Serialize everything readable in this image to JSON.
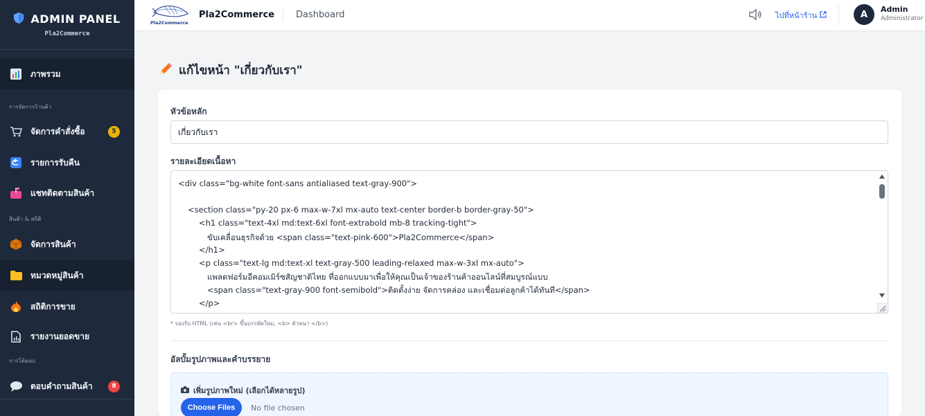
{
  "sidebar": {
    "title": "ADMIN PANEL",
    "subtitle": "Pla2Commerce",
    "sections": [
      "การจัดการร้านค้า",
      "สินค้า & สถิติ",
      "การโต้ตอบ"
    ],
    "items": [
      {
        "label": "ภาพรวม",
        "icon": "bar-chart-icon"
      },
      {
        "label": "จัดการคำสั่งซื้อ",
        "icon": "shopping-cart-icon",
        "badge": "5"
      },
      {
        "label": "รายการรับคืน",
        "icon": "return-arrow-icon"
      },
      {
        "label": "แชทติดตามสินค้า",
        "icon": "mailbox-icon"
      },
      {
        "label": "จัดการสินค้า",
        "icon": "package-icon"
      },
      {
        "label": "หมวดหมู่สินค้า",
        "icon": "folder-icon"
      },
      {
        "label": "สถิติการขาย",
        "icon": "fire-icon"
      },
      {
        "label": "รายงานยอดขาย",
        "icon": "report-icon"
      },
      {
        "label": "ตอบคำถามสินค้า",
        "icon": "speech-bubble-icon",
        "badge": "8"
      }
    ]
  },
  "header": {
    "store_name": "Pla2Commerce",
    "page": "Dashboard",
    "logo_text": "Pla2Commerce",
    "store_link": "ไปที่หน้าร้าน",
    "user": {
      "initial": "A",
      "name": "Admin",
      "role": "Administrator"
    }
  },
  "main": {
    "title": "แก้ไขหน้า \"เกี่ยวกับเรา\"",
    "heading_label": "หัวข้อหลัก",
    "heading_value": "เกี่ยวกับเรา",
    "content_label": "รายละเอียดเนื้อหา",
    "content_lines": [
      "<div class=\"bg-white font-sans antialiased text-gray-900\">",
      "",
      "<section class=\"py-20 px-6 max-w-7xl mx-auto text-center border-b border-gray-50\">",
      "<h1 class=\"text-4xl md:text-6xl font-extrabold mb-8 tracking-tight\">",
      "ขับเคลื่อนธุรกิจด้วย <span class=\"text-pink-600\">Pla2Commerce</span>",
      "</h1>",
      "<p class=\"text-lg md:text-xl text-gray-500 leading-relaxed max-w-3xl mx-auto\">",
      "แพลตฟอร์มอีคอมเมิร์ซสัญชาติไทย ที่ออกแบบมาเพื่อให้คุณเป็นเจ้าของร้านค้าออนไลน์ที่สมบูรณ์แบบ",
      "<span class=\"text-gray-900 font-semibold\">ติดตั้งง่าย จัดการคล่อง และเชื่อมต่อลูกค้าได้ทันที</span>",
      "</p>"
    ],
    "content_hint": "* รองรับ HTML (เช่น <br> ขึ้นบรรทัดใหม่, <b> ตัวหนา </b>)",
    "album_label": "อัลบั้มรูปภาพและคำบรรยาย",
    "upload_label": "เพิ่มรูปภาพใหม่ (เลือกได้หลายรูป)",
    "choose_files": "Choose Files",
    "file_status": "No file chosen"
  },
  "colors": {
    "sidebar_bg": "#1e293b",
    "accent": "#2563eb",
    "badge_yellow": "#eab308",
    "badge_red": "#ef4444"
  }
}
